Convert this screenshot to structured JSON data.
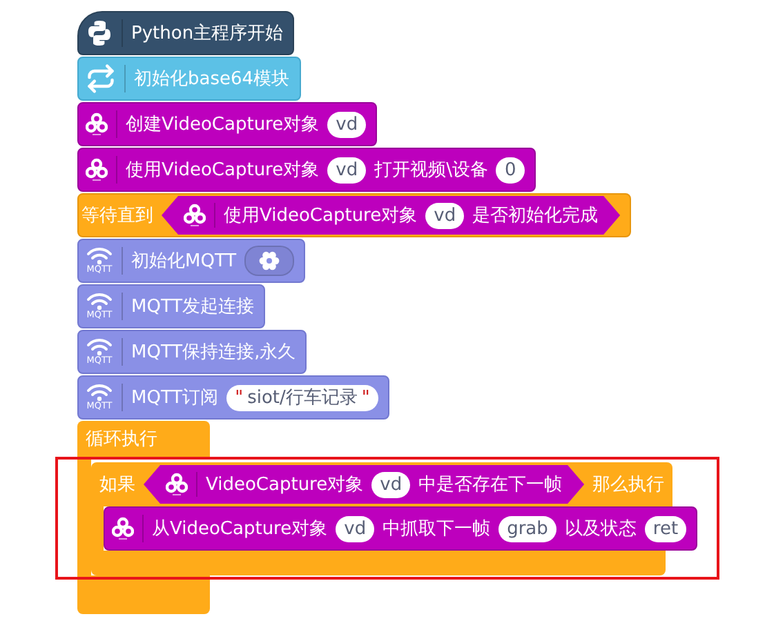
{
  "script": [
    {
      "kind": "python",
      "parts": [
        {
          "kind": "text",
          "text": "Python主程序开始"
        }
      ]
    },
    {
      "kind": "base64",
      "parts": [
        {
          "kind": "text",
          "text": "初始化base64模块"
        }
      ]
    },
    {
      "kind": "opencv",
      "parts": [
        {
          "kind": "text",
          "text": "创建VideoCapture对象"
        },
        {
          "kind": "slot",
          "text": "vd"
        }
      ]
    },
    {
      "kind": "opencv",
      "parts": [
        {
          "kind": "text",
          "text": "使用VideoCapture对象"
        },
        {
          "kind": "slot",
          "text": "vd"
        },
        {
          "kind": "text",
          "text": "打开视频\\设备"
        },
        {
          "kind": "slot",
          "text": "0"
        }
      ]
    },
    {
      "kind": "wait",
      "label": "等待直到",
      "condition": {
        "kind": "opencv",
        "parts": [
          {
            "kind": "text",
            "text": "使用VideoCapture对象"
          },
          {
            "kind": "slot",
            "text": "vd"
          },
          {
            "kind": "text",
            "text": "是否初始化完成"
          }
        ]
      }
    },
    {
      "kind": "mqtt",
      "icon_caption": "MQTT",
      "parts": [
        {
          "kind": "text",
          "text": "初始化MQTT"
        },
        {
          "kind": "gear"
        }
      ]
    },
    {
      "kind": "mqtt",
      "icon_caption": "MQTT",
      "parts": [
        {
          "kind": "text",
          "text": "MQTT发起连接"
        }
      ]
    },
    {
      "kind": "mqtt",
      "icon_caption": "MQTT",
      "parts": [
        {
          "kind": "text",
          "text": "MQTT保持连接,永久"
        }
      ]
    },
    {
      "kind": "mqtt",
      "icon_caption": "MQTT",
      "parts": [
        {
          "kind": "text",
          "text": "MQTT订阅"
        },
        {
          "kind": "string",
          "open_quote": "\"",
          "text": "siot/行车记录",
          "close_quote": "\""
        }
      ]
    },
    {
      "kind": "forever",
      "label": "循环执行",
      "body": [
        {
          "kind": "if",
          "label": "如果",
          "then_label": "那么执行",
          "highlighted": true,
          "condition": {
            "kind": "opencv",
            "parts": [
              {
                "kind": "text",
                "text": "VideoCapture对象"
              },
              {
                "kind": "slot",
                "text": "vd"
              },
              {
                "kind": "text",
                "text": "中是否存在下一帧"
              }
            ]
          },
          "body": [
            {
              "kind": "opencv",
              "parts": [
                {
                  "kind": "text",
                  "text": "从VideoCapture对象"
                },
                {
                  "kind": "slot",
                  "text": "vd"
                },
                {
                  "kind": "text",
                  "text": "中抓取下一帧"
                },
                {
                  "kind": "slot",
                  "text": "grab"
                },
                {
                  "kind": "text",
                  "text": "以及状态"
                },
                {
                  "kind": "slot",
                  "text": "ret"
                }
              ]
            }
          ]
        }
      ]
    }
  ]
}
